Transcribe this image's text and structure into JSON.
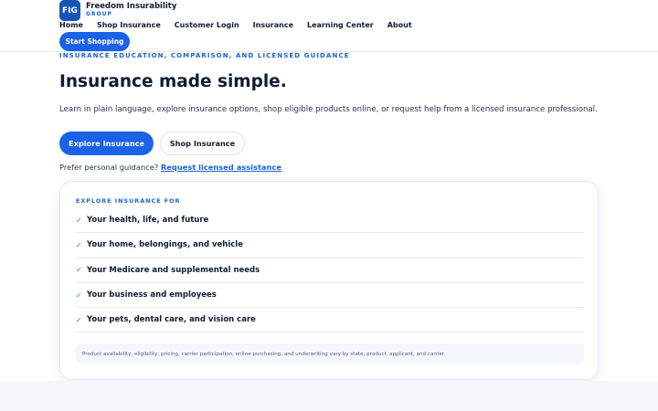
{
  "brand": {
    "logo_text": "FIG",
    "name": "Freedom Insurability",
    "sub": "GROUP"
  },
  "nav": {
    "items": [
      "Home",
      "Shop Insurance",
      "Customer Login",
      "Insurance",
      "Learning Center",
      "About"
    ],
    "cta": "Start Shopping"
  },
  "hero": {
    "eyebrow": "INSURANCE EDUCATION, COMPARISON, AND LICENSED GUIDANCE",
    "title": "Insurance made simple.",
    "description": "Learn in plain language, explore insurance options, shop eligible products online, or request help from a licensed insurance professional.",
    "primary_button": "Explore Insurance",
    "secondary_button": "Shop Insurance",
    "assist_prefix": "Prefer personal guidance?",
    "assist_link": "Request licensed assistance"
  },
  "card": {
    "eyebrow": "EXPLORE INSURANCE FOR",
    "items": [
      "Your health, life, and future",
      "Your home, belongings, and vehicle",
      "Your Medicare and supplemental needs",
      "Your business and employees",
      "Your pets, dental care, and vision care"
    ],
    "check_glyph": "✓",
    "disclaimer": "Product availability, eligibility, pricing, carrier participation, online purchasing, and underwriting vary by state, product, applicant, and carrier."
  },
  "colors": {
    "accent": "#1a62e6",
    "brand_dark": "#1456b8",
    "text": "#111c33",
    "check": "#1a8c7a"
  }
}
